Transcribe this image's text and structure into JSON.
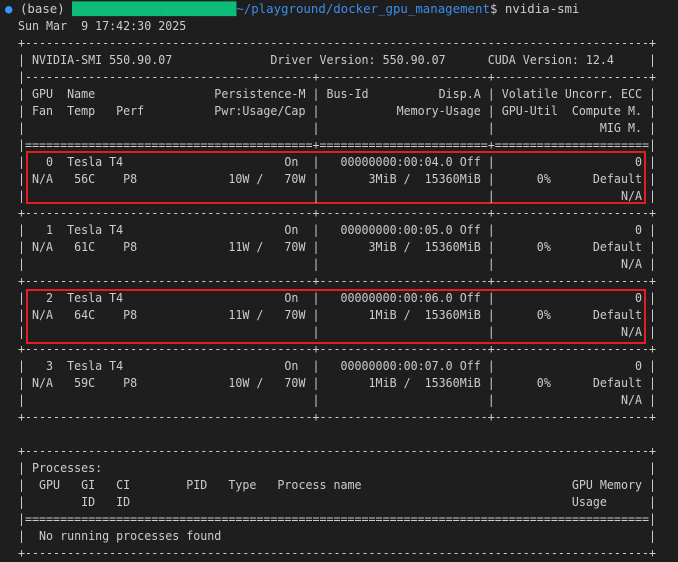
{
  "prompt": {
    "bullet": "●",
    "env": "(base)",
    "user_host_redacted": "██████████████████████",
    "path": "~/playground/docker_gpu_management",
    "symbol": "$",
    "command": "nvidia-smi"
  },
  "lines": [
    "Sun Mar  9 17:42:30 2025",
    "+-----------------------------------------------------------------------------------------+",
    "| NVIDIA-SMI 550.90.07              Driver Version: 550.90.07      CUDA Version: 12.4     |",
    "|-----------------------------------------+------------------------+----------------------+",
    "| GPU  Name                 Persistence-M | Bus-Id          Disp.A | Volatile Uncorr. ECC |",
    "| Fan  Temp   Perf          Pwr:Usage/Cap |           Memory-Usage | GPU-Util  Compute M. |",
    "|                                         |                        |               MIG M. |",
    "|=========================================+========================+======================|",
    "|   0  Tesla T4                       On  |   00000000:00:04.0 Off |                    0 |",
    "| N/A   56C    P8             10W /   70W |       3MiB /  15360MiB |      0%      Default |",
    "|                                         |                        |                  N/A |",
    "+-----------------------------------------+------------------------+----------------------+",
    "|   1  Tesla T4                       On  |   00000000:00:05.0 Off |                    0 |",
    "| N/A   61C    P8             11W /   70W |       3MiB /  15360MiB |      0%      Default |",
    "|                                         |                        |                  N/A |",
    "+-----------------------------------------+------------------------+----------------------+",
    "|   2  Tesla T4                       On  |   00000000:00:06.0 Off |                    0 |",
    "| N/A   64C    P8             11W /   70W |       1MiB /  15360MiB |      0%      Default |",
    "|                                         |                        |                  N/A |",
    "+-----------------------------------------+------------------------+----------------------+",
    "|   3  Tesla T4                       On  |   00000000:00:07.0 Off |                    0 |",
    "| N/A   59C    P8             10W /   70W |       1MiB /  15360MiB |      0%      Default |",
    "|                                         |                        |                  N/A |",
    "+-----------------------------------------+------------------------+----------------------+",
    "",
    "+-----------------------------------------------------------------------------------------+",
    "| Processes:                                                                              |",
    "|  GPU   GI   CI        PID   Type   Process name                              GPU Memory |",
    "|        ID   ID                                                               Usage      |",
    "|=========================================================================================|",
    "|  No running processes found                                                             |",
    "+-----------------------------------------------------------------------------------------+"
  ],
  "highlight_color": "#e51c23"
}
